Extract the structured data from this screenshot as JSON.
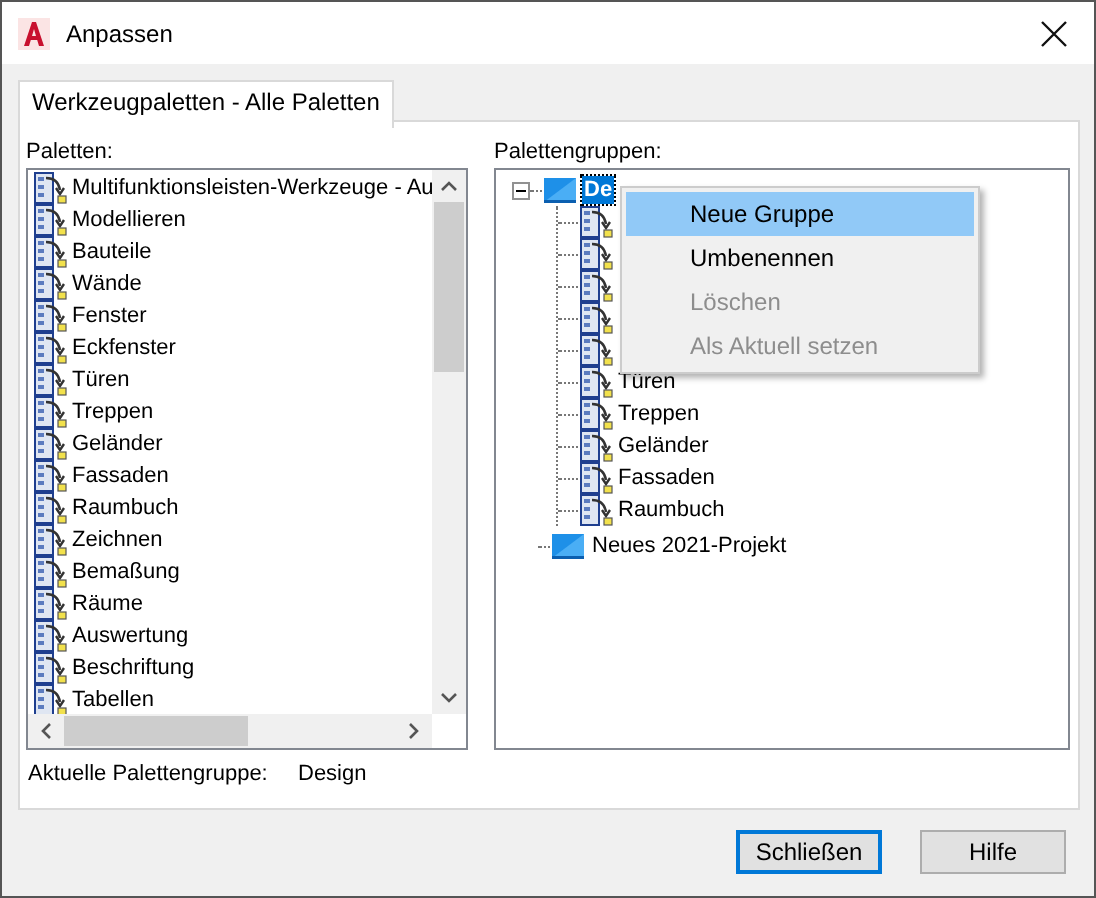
{
  "window": {
    "title": "Anpassen"
  },
  "tabs": [
    {
      "label": "Werkzeugpaletten - Alle Paletten",
      "selected": true
    }
  ],
  "palettes": {
    "label": "Paletten:",
    "items": [
      {
        "label": "Multifunktionsleisten-Werkzeuge - Au"
      },
      {
        "label": "Modellieren"
      },
      {
        "label": "Bauteile"
      },
      {
        "label": "Wände"
      },
      {
        "label": "Fenster"
      },
      {
        "label": "Eckfenster"
      },
      {
        "label": "Türen"
      },
      {
        "label": "Treppen"
      },
      {
        "label": "Geländer"
      },
      {
        "label": "Fassaden"
      },
      {
        "label": "Raumbuch"
      },
      {
        "label": "Zeichnen"
      },
      {
        "label": "Bemaßung"
      },
      {
        "label": "Räume"
      },
      {
        "label": "Auswertung"
      },
      {
        "label": "Beschriftung"
      },
      {
        "label": "Tabellen"
      }
    ]
  },
  "palette_groups": {
    "label": "Palettengruppen:",
    "tree": [
      {
        "label": "De",
        "kind": "group",
        "selected": true,
        "expanded": true,
        "children": [
          {
            "kind": "palette"
          },
          {
            "kind": "palette"
          },
          {
            "kind": "palette"
          },
          {
            "kind": "palette"
          },
          {
            "kind": "palette"
          },
          {
            "label": "Türen",
            "kind": "palette"
          },
          {
            "label": "Treppen",
            "kind": "palette"
          },
          {
            "label": "Geländer",
            "kind": "palette"
          },
          {
            "label": "Fassaden",
            "kind": "palette"
          },
          {
            "label": "Raumbuch",
            "kind": "palette"
          }
        ]
      },
      {
        "label": "Neues 2021-Projekt",
        "kind": "group",
        "selected": false
      }
    ]
  },
  "context_menu": [
    {
      "label": "Neue Gruppe",
      "disabled": false,
      "selected": true
    },
    {
      "label": "Umbenennen",
      "disabled": false,
      "selected": false
    },
    {
      "label": "Löschen",
      "disabled": true,
      "selected": false
    },
    {
      "label": "Als Aktuell setzen",
      "disabled": true,
      "selected": false
    }
  ],
  "current_group": {
    "label": "Aktuelle Palettengruppe:",
    "value": "Design"
  },
  "buttons": [
    {
      "label": "Schließen",
      "default": true
    },
    {
      "label": "Hilfe",
      "default": false
    }
  ]
}
